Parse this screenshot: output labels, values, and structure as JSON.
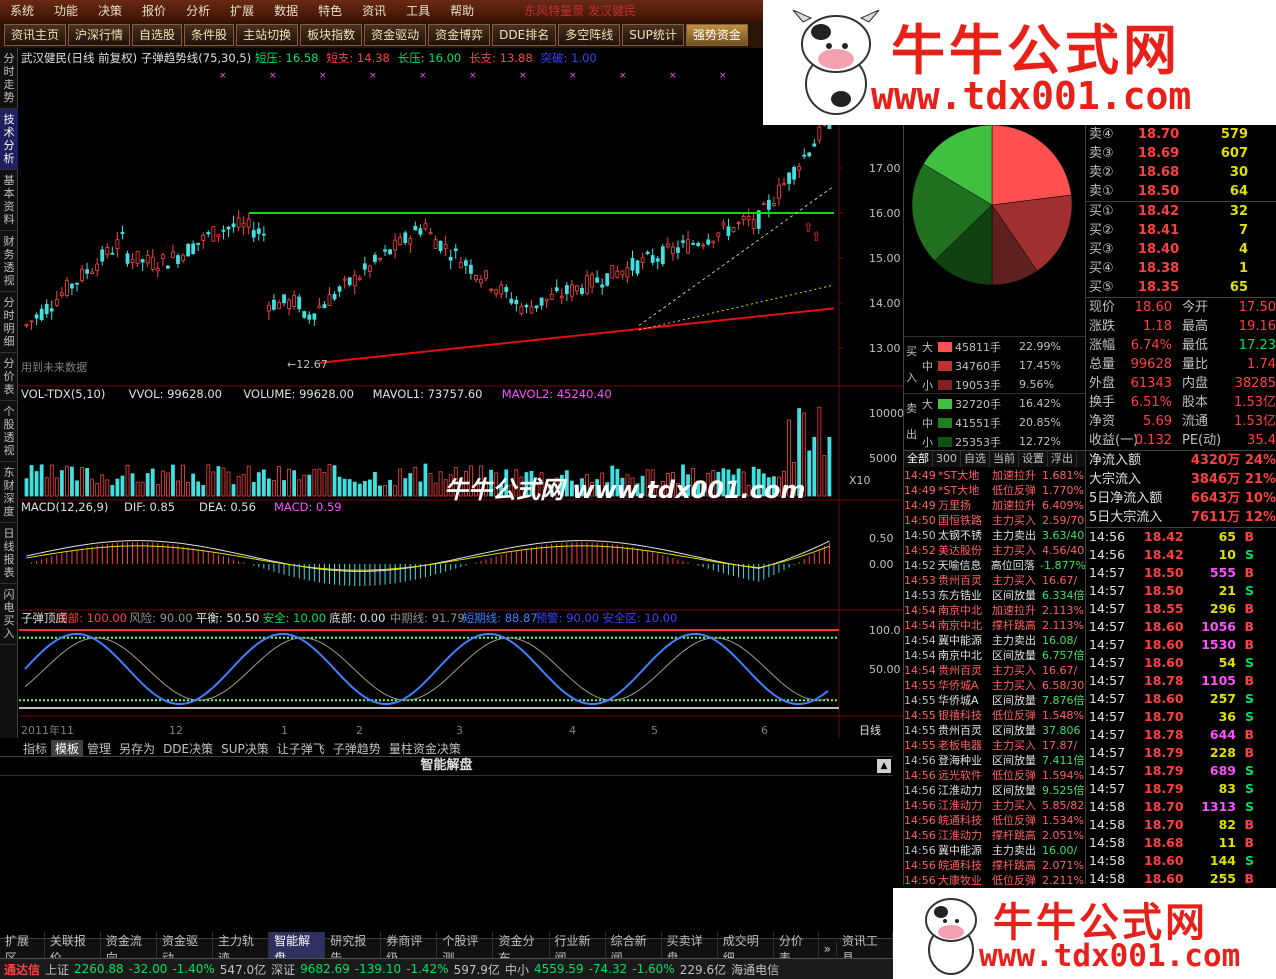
{
  "menu": {
    "items": [
      "系统",
      "功能",
      "决策",
      "报价",
      "分析",
      "扩展",
      "数据",
      "特色",
      "资讯",
      "工具",
      "帮助"
    ],
    "ticker": "东风特量景 发汉健民"
  },
  "toolbar": {
    "items": [
      "资讯主页",
      "沪深行情",
      "自选股",
      "条件股",
      "主站切换",
      "板块指数",
      "资金驱动",
      "资金博弈",
      "DDE排名",
      "多空阵线",
      "SUP统计",
      "强势资金"
    ],
    "active": "强势资金"
  },
  "left_tabs": [
    "分时走势",
    "技术分析",
    "基本资料",
    "财务透视",
    "分时明细",
    "分价表",
    "个股透视",
    "东财深度",
    "日线报表",
    "闪电买入"
  ],
  "chart_header": {
    "title": "武汉健民(日线 前复权) 子弹趋势线(75,30,5)",
    "items": [
      {
        "t": "短压: 16.58",
        "c": "#00e060"
      },
      {
        "t": "短支: 14.38",
        "c": "#ff4040"
      },
      {
        "t": "长压: 16.00",
        "c": "#00e060"
      },
      {
        "t": "长支: 13.88",
        "c": "#ff4040"
      },
      {
        "t": "突破: 1.00",
        "c": "#4040ff"
      }
    ]
  },
  "price_axis": [
    "17.00",
    "16.00",
    "15.00",
    "14.00",
    "13.00"
  ],
  "low_label": "←12.67",
  "future_label": "用到未来数据",
  "vol_header": {
    "items": [
      {
        "t": "VOL-TDX(5,10)",
        "c": "#e0e0e0"
      },
      {
        "t": "VVOL: 99628.00",
        "c": "#e0e0e0"
      },
      {
        "t": "VOLUME: 99628.00",
        "c": "#e0e0e0"
      },
      {
        "t": "MAVOL1: 73757.60",
        "c": "#e0e0e0"
      },
      {
        "t": "MAVOL2: 45240.40",
        "c": "#ff50ff"
      }
    ]
  },
  "vol_axis": [
    "10000",
    "5000",
    "X10"
  ],
  "macd_header": {
    "items": [
      {
        "t": "MACD(12,26,9)",
        "c": "#e0e0e0"
      },
      {
        "t": "DIF: 0.85",
        "c": "#e0e0e0"
      },
      {
        "t": "DEA: 0.56",
        "c": "#e0e0e0"
      },
      {
        "t": "MACD: 0.59",
        "c": "#ff50ff"
      }
    ]
  },
  "macd_axis": [
    "0.50",
    "0.00"
  ],
  "osc_header": {
    "items": [
      {
        "t": "子弹顶底",
        "c": "#e0e0e0"
      },
      {
        "t": "顶部: 100.00",
        "c": "#ff4040"
      },
      {
        "t": "风险: 90.00",
        "c": "#909090"
      },
      {
        "t": "平衡: 50.50",
        "c": "#e0e0e0"
      },
      {
        "t": "安全: 10.00",
        "c": "#00e060"
      },
      {
        "t": "底部: 0.00",
        "c": "#e0e0e0"
      },
      {
        "t": "中期线: 91.79",
        "c": "#909090"
      },
      {
        "t": "短期线: 88.87",
        "c": "#4080ff"
      },
      {
        "t": "预警: 90.00",
        "c": "#4040ff"
      },
      {
        "t": "安全区: 10.00",
        "c": "#4040ff"
      }
    ]
  },
  "osc_axis": [
    "100.0",
    "50.00"
  ],
  "date_axis": [
    "2011年11",
    "12",
    "1",
    "2",
    "3",
    "4",
    "5",
    "6"
  ],
  "period": "日线",
  "subtabs": [
    "指标",
    "模板",
    "管理",
    "另存为",
    "DDE决策",
    "SUP决策",
    "让子弹飞",
    "子弹趋势",
    "量柱资金决策"
  ],
  "subtab_selected": "模板",
  "panel_title": "智能解盘",
  "overlay_text": "牛牛公式网 www.tdx001.com",
  "watermark": {
    "title": "牛牛公式网",
    "url": "www.tdx001.com"
  },
  "order_book": {
    "asks": [
      {
        "l": "卖④",
        "p": "18.70",
        "v": "579"
      },
      {
        "l": "卖③",
        "p": "18.69",
        "v": "607"
      },
      {
        "l": "卖②",
        "p": "18.68",
        "v": "30"
      },
      {
        "l": "卖①",
        "p": "18.50",
        "v": "64"
      }
    ],
    "bids": [
      {
        "l": "买①",
        "p": "18.42",
        "v": "32"
      },
      {
        "l": "买②",
        "p": "18.41",
        "v": "7"
      },
      {
        "l": "买③",
        "p": "18.40",
        "v": "4"
      },
      {
        "l": "买④",
        "p": "18.38",
        "v": "1"
      },
      {
        "l": "买⑤",
        "p": "18.35",
        "v": "65"
      }
    ]
  },
  "quote": [
    {
      "a": "现价",
      "av": "18.60",
      "b": "今开",
      "bv": "17.50"
    },
    {
      "a": "涨跌",
      "av": "1.18",
      "b": "最高",
      "bv": "19.16"
    },
    {
      "a": "涨幅",
      "av": "6.74%",
      "b": "最低",
      "bv": "17.23"
    },
    {
      "a": "总量",
      "av": "99628",
      "b": "量比",
      "bv": "1.74"
    },
    {
      "a": "外盘",
      "av": "61343",
      "b": "内盘",
      "bv": "38285"
    },
    {
      "a": "换手",
      "av": "6.51%",
      "b": "股本",
      "bv": "1.53亿"
    },
    {
      "a": "净资",
      "av": "5.69",
      "b": "流通",
      "bv": "1.53亿"
    },
    {
      "a": "收益(一)",
      "av": "0.132",
      "b": "PE(动)",
      "bv": "35.4"
    }
  ],
  "flows": [
    {
      "l": "净流入额",
      "v": "4320万",
      "p": "24%"
    },
    {
      "l": "大宗流入",
      "v": "3846万",
      "p": "21%"
    },
    {
      "l": "5日净流入额",
      "v": "6643万",
      "p": "10%"
    },
    {
      "l": "5日大宗流入",
      "v": "7611万",
      "p": "12%"
    }
  ],
  "ticks": [
    {
      "t": "14:56",
      "p": "18.42",
      "v": "65",
      "s": "B"
    },
    {
      "t": "14:56",
      "p": "18.42",
      "v": "10",
      "s": "S"
    },
    {
      "t": "14:57",
      "p": "18.50",
      "v": "555",
      "s": "B"
    },
    {
      "t": "14:57",
      "p": "18.50",
      "v": "21",
      "s": "S"
    },
    {
      "t": "14:57",
      "p": "18.55",
      "v": "296",
      "s": "B"
    },
    {
      "t": "14:57",
      "p": "18.60",
      "v": "1056",
      "s": "B"
    },
    {
      "t": "14:57",
      "p": "18.60",
      "v": "1530",
      "s": "B"
    },
    {
      "t": "14:57",
      "p": "18.60",
      "v": "54",
      "s": "S"
    },
    {
      "t": "14:57",
      "p": "18.78",
      "v": "1105",
      "s": "B"
    },
    {
      "t": "14:57",
      "p": "18.60",
      "v": "257",
      "s": "S"
    },
    {
      "t": "14:57",
      "p": "18.70",
      "v": "36",
      "s": "S"
    },
    {
      "t": "14:57",
      "p": "18.78",
      "v": "644",
      "s": "B"
    },
    {
      "t": "14:57",
      "p": "18.79",
      "v": "228",
      "s": "B"
    },
    {
      "t": "14:57",
      "p": "18.79",
      "v": "689",
      "s": "S"
    },
    {
      "t": "14:57",
      "p": "18.79",
      "v": "83",
      "s": "S"
    },
    {
      "t": "14:58",
      "p": "18.70",
      "v": "1313",
      "s": "S"
    },
    {
      "t": "14:58",
      "p": "18.70",
      "v": "82",
      "s": "B"
    },
    {
      "t": "14:58",
      "p": "18.68",
      "v": "11",
      "s": "B"
    },
    {
      "t": "14:58",
      "p": "18.60",
      "v": "144",
      "s": "S"
    },
    {
      "t": "14:58",
      "p": "18.60",
      "v": "255",
      "s": "B"
    }
  ],
  "big_orders": {
    "buy": [
      {
        "s": "大",
        "v": "45811手",
        "p": "22.99%",
        "c": "#ff5050"
      },
      {
        "s": "中",
        "v": "34760手",
        "p": "17.45%",
        "c": "#c03030"
      },
      {
        "s": "小",
        "v": "19053手",
        "p": "9.56%",
        "c": "#802020"
      }
    ],
    "sell": [
      {
        "s": "大",
        "v": "32720手",
        "p": "16.42%",
        "c": "#40c040"
      },
      {
        "s": "中",
        "v": "41551手",
        "p": "20.85%",
        "c": "#208020"
      },
      {
        "s": "小",
        "v": "25353手",
        "p": "12.72%",
        "c": "#105010"
      }
    ],
    "buy_label": "买入",
    "sell_label": "卖出"
  },
  "pie": [
    {
      "v": 22.99,
      "c": "#ff5050"
    },
    {
      "v": 17.45,
      "c": "#a03030"
    },
    {
      "v": 9.56,
      "c": "#602020"
    },
    {
      "v": 12.72,
      "c": "#104010"
    },
    {
      "v": 20.85,
      "c": "#207020"
    },
    {
      "v": 16.42,
      "c": "#40c040"
    }
  ],
  "radar_tabs": [
    "全部",
    "300",
    "自选",
    "当前",
    "设置",
    "浮出"
  ],
  "radar": [
    {
      "t": "14:49",
      "n": "*ST大地",
      "e": "加速拉升",
      "v": "1.681%"
    },
    {
      "t": "14:49",
      "n": "*ST大地",
      "e": "低位反弹",
      "v": "1.770%"
    },
    {
      "t": "14:49",
      "n": "万里扬",
      "e": "加速拉升",
      "v": "6.409%"
    },
    {
      "t": "14:50",
      "n": "国恒铁路",
      "e": "主力买入",
      "v": "2.59/70"
    },
    {
      "t": "14:50",
      "n": "太钢不锈",
      "e": "主力卖出",
      "v": "3.63/40"
    },
    {
      "t": "14:52",
      "n": "美达股份",
      "e": "主力买入",
      "v": "4.56/40"
    },
    {
      "t": "14:52",
      "n": "天喻信息",
      "e": "高位回落",
      "v": "-1.877%"
    },
    {
      "t": "14:53",
      "n": "贵州百灵",
      "e": "主力买入",
      "v": "16.67/"
    },
    {
      "t": "14:53",
      "n": "东方锆业",
      "e": "区间放量",
      "v": "6.334倍"
    },
    {
      "t": "14:54",
      "n": "南京中北",
      "e": "加速拉升",
      "v": "2.113%"
    },
    {
      "t": "14:54",
      "n": "南京中北",
      "e": "撑杆跳高",
      "v": "2.113%"
    },
    {
      "t": "14:54",
      "n": "冀中能源",
      "e": "主力卖出",
      "v": "16.08/"
    },
    {
      "t": "14:54",
      "n": "南京中北",
      "e": "区间放量",
      "v": "6.757倍"
    },
    {
      "t": "14:54",
      "n": "贵州百灵",
      "e": "主力买入",
      "v": "16.67/"
    },
    {
      "t": "14:55",
      "n": "华侨城A",
      "e": "主力买入",
      "v": "6.58/30"
    },
    {
      "t": "14:55",
      "n": "华侨城A",
      "e": "区间放量",
      "v": "7.876倍"
    },
    {
      "t": "14:55",
      "n": "银禧科技",
      "e": "低位反弹",
      "v": "1.548%"
    },
    {
      "t": "14:55",
      "n": "贵州百灵",
      "e": "区间放量",
      "v": "37.806"
    },
    {
      "t": "14:55",
      "n": "老板电器",
      "e": "主力买入",
      "v": "17.87/"
    },
    {
      "t": "14:56",
      "n": "登海种业",
      "e": "区间放量",
      "v": "7.411倍"
    },
    {
      "t": "14:56",
      "n": "远光软件",
      "e": "低位反弹",
      "v": "1.594%"
    },
    {
      "t": "14:56",
      "n": "江淮动力",
      "e": "区间放量",
      "v": "9.525倍"
    },
    {
      "t": "14:56",
      "n": "江淮动力",
      "e": "主力买入",
      "v": "5.85/82"
    },
    {
      "t": "14:56",
      "n": "皖通科技",
      "e": "低位反弹",
      "v": "1.534%"
    },
    {
      "t": "14:56",
      "n": "江淮动力",
      "e": "撑杆跳高",
      "v": "2.051%"
    },
    {
      "t": "14:56",
      "n": "冀中能源",
      "e": "主力卖出",
      "v": "16.00/"
    },
    {
      "t": "14:56",
      "n": "皖通科技",
      "e": "撑杆跳高",
      "v": "2.071%"
    },
    {
      "t": "14:56",
      "n": "大康牧业",
      "e": "低位反弹",
      "v": "2.211%"
    }
  ],
  "bottom_tabs": [
    "扩展区",
    "关联报价",
    "资金流向",
    "资金驱动",
    "主力轨迹",
    "智能解盘",
    "研究报告",
    "券商评级",
    "个股评测",
    "资金分布",
    "行业新闻",
    "综合新闻",
    "买卖详盘",
    "成交明细",
    "分价表",
    "»",
    "资讯工具"
  ],
  "bottom_selected": "智能解盘",
  "status": [
    {
      "t": "通达信",
      "c": "#ff4040"
    },
    {
      "t": "上证",
      "c": "#c0c0c0"
    },
    {
      "t": "2260.88",
      "c": "#00e060"
    },
    {
      "t": "-32.00",
      "c": "#00e060"
    },
    {
      "t": "-1.40%",
      "c": "#00e060"
    },
    {
      "t": "547.0亿",
      "c": "#c0c0c0"
    },
    {
      "t": "深证",
      "c": "#c0c0c0"
    },
    {
      "t": "9682.69",
      "c": "#00e060"
    },
    {
      "t": "-139.10",
      "c": "#00e060"
    },
    {
      "t": "-1.42%",
      "c": "#00e060"
    },
    {
      "t": "597.9亿",
      "c": "#c0c0c0"
    },
    {
      "t": "中小",
      "c": "#c0c0c0"
    },
    {
      "t": "4559.59",
      "c": "#00e060"
    },
    {
      "t": "-74.32",
      "c": "#00e060"
    },
    {
      "t": "-1.60%",
      "c": "#00e060"
    },
    {
      "t": "229.6亿",
      "c": "#c0c0c0"
    },
    {
      "t": "海通电信",
      "c": "#c0c0c0"
    }
  ]
}
